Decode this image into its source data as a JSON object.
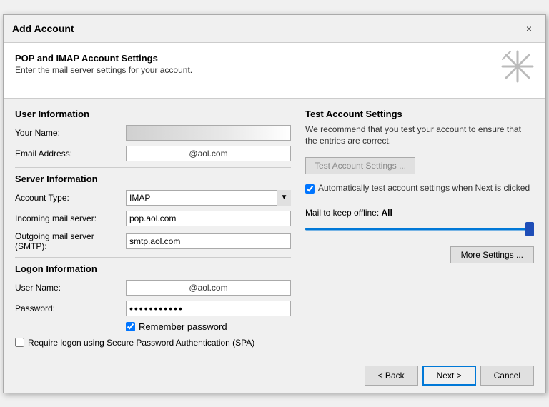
{
  "dialog": {
    "title": "Add Account",
    "close_label": "×"
  },
  "header": {
    "title": "POP and IMAP Account Settings",
    "subtitle": "Enter the mail server settings for your account.",
    "icon": "✳"
  },
  "left": {
    "user_section_title": "User Information",
    "your_name_label": "Your Name:",
    "your_name_value": "",
    "email_label": "Email Address:",
    "email_value": "@aol.com",
    "server_section_title": "Server Information",
    "account_type_label": "Account Type:",
    "account_type_value": "IMAP",
    "incoming_label": "Incoming mail server:",
    "incoming_value": "pop.aol.com",
    "outgoing_label": "Outgoing mail server (SMTP):",
    "outgoing_value": "smtp.aol.com",
    "logon_section_title": "Logon Information",
    "username_label": "User Name:",
    "username_value": "@aol.com",
    "password_label": "Password:",
    "password_value": "***********",
    "remember_label": "Remember password",
    "spa_label": "Require logon using Secure Password Authentication (SPA)"
  },
  "right": {
    "section_title": "Test Account Settings",
    "desc": "We recommend that you test your account to ensure that the entries are correct.",
    "test_btn_label": "Test Account Settings ...",
    "auto_test_label": "Automatically test account settings when Next is clicked",
    "offline_label": "Mail to keep offline:",
    "offline_value": "All",
    "more_settings_label": "More Settings ..."
  },
  "footer": {
    "back_label": "< Back",
    "next_label": "Next >",
    "cancel_label": "Cancel"
  }
}
